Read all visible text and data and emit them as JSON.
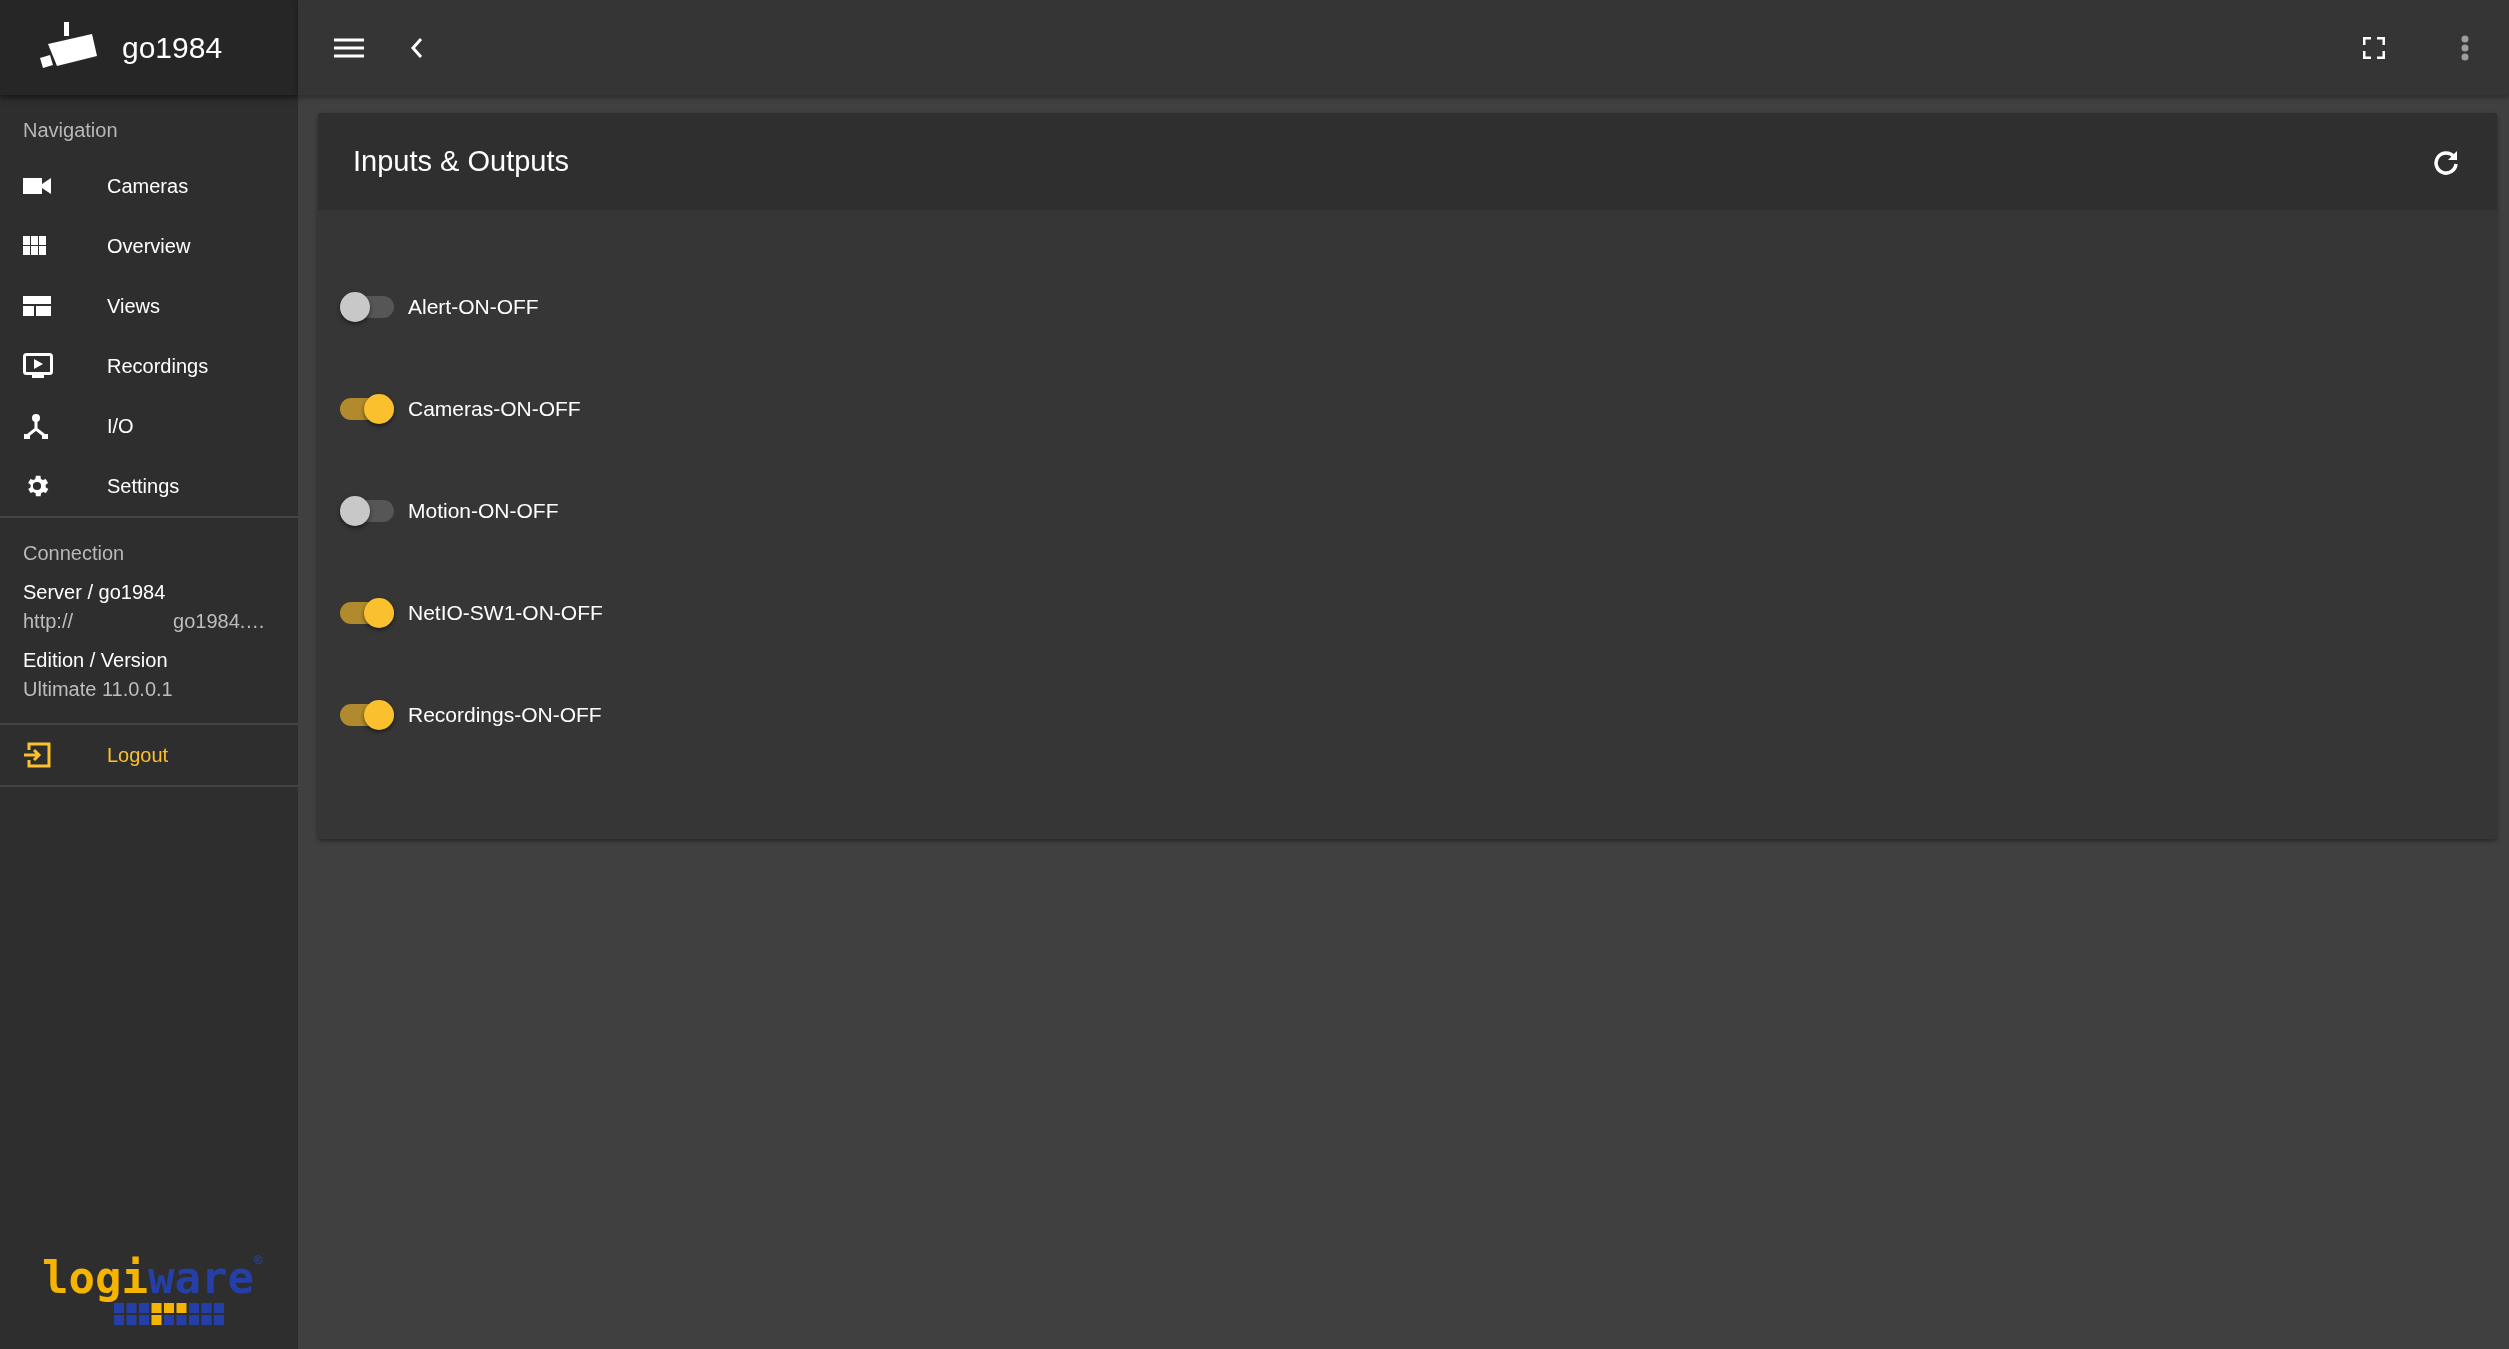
{
  "app": {
    "title": "go1984"
  },
  "navigation": {
    "heading": "Navigation",
    "items": [
      {
        "kind": "camera",
        "label": "Cameras"
      },
      {
        "kind": "grid",
        "label": "Overview"
      },
      {
        "kind": "views",
        "label": "Views"
      },
      {
        "kind": "recordings",
        "label": "Recordings"
      },
      {
        "kind": "io",
        "label": "I/O"
      },
      {
        "kind": "settings",
        "label": "Settings"
      }
    ]
  },
  "connection": {
    "heading": "Connection",
    "server_label": "Server / go1984",
    "server_url_start": "http://",
    "server_url_end": "go1984.…",
    "edition_label": "Edition / Version",
    "edition_value": "Ultimate 11.0.0.1"
  },
  "logout": {
    "label": "Logout"
  },
  "logo": {
    "part_a": "logi",
    "part_b": "ware",
    "mark": "®"
  },
  "card": {
    "title": "Inputs & Outputs",
    "switches": [
      {
        "label": "Alert-ON-OFF",
        "on": false
      },
      {
        "label": "Cameras-ON-OFF",
        "on": true
      },
      {
        "label": "Motion-ON-OFF",
        "on": false
      },
      {
        "label": "NetIO-SW1-ON-OFF",
        "on": true
      },
      {
        "label": "Recordings-ON-OFF",
        "on": true
      }
    ]
  }
}
